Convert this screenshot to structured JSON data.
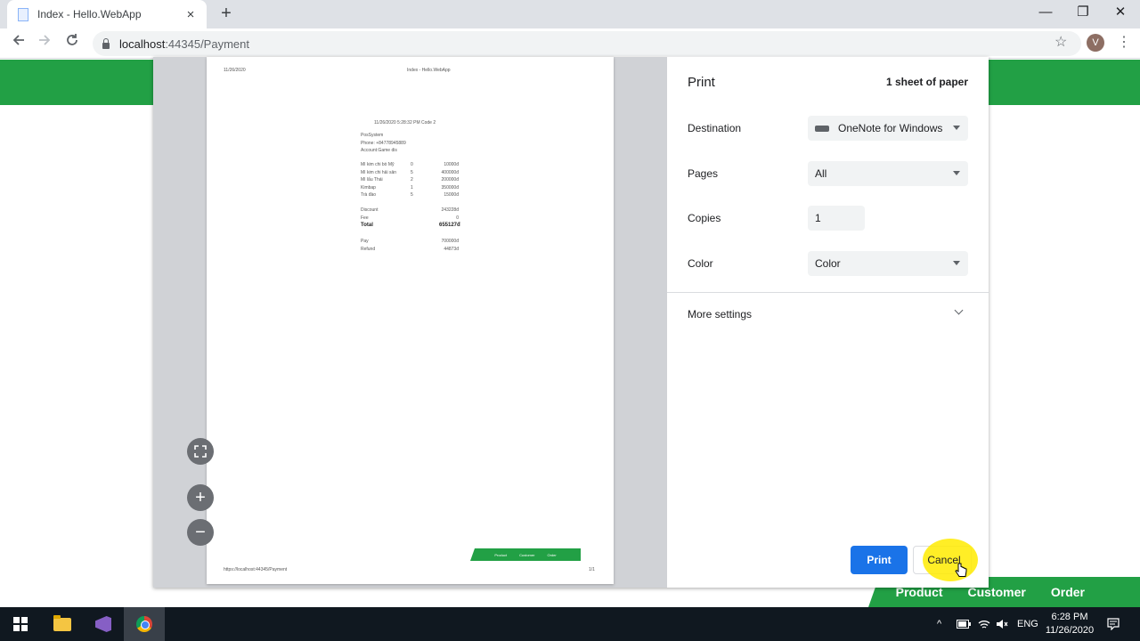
{
  "browser": {
    "tab_title": "Index - Hello.WebApp",
    "tab_close": "×",
    "new_tab": "+",
    "url_host": "localhost",
    "url_path": ":44345/Payment",
    "avatar_letter": "V",
    "window_controls": {
      "minimize": "—",
      "restore": "❐",
      "close": "✕"
    }
  },
  "page_nav": {
    "items": [
      "Product",
      "Customer",
      "Order"
    ]
  },
  "preview": {
    "header_left": "11/26/2020",
    "header_center": "Index - Hello.WebApp",
    "receipt_date": "11/26/2020 5:28:32 PM Code 2",
    "shop": [
      "PosSystem",
      "Phone: +84778945889",
      "Account:Game dis"
    ],
    "items": [
      {
        "name": "Mì kim chi bò Mỹ",
        "qty": "0",
        "price": "10000đ"
      },
      {
        "name": "Mì kim chi hải sản",
        "qty": "5",
        "price": "400000đ"
      },
      {
        "name": "Mì lẩu Thái",
        "qty": "2",
        "price": "200000đ"
      },
      {
        "name": "Kimbap",
        "qty": "1",
        "price": "350000đ"
      },
      {
        "name": "Trà đào",
        "qty": "5",
        "price": "15000đ"
      }
    ],
    "discount_label": "Discount",
    "discount_value": "243228đ",
    "fee_label": "Fee",
    "fee_value": "0",
    "total_label": "Total",
    "total_value": "655127đ",
    "pay_label": "Pay",
    "pay_value": "700000đ",
    "refund_label": "Refund",
    "refund_value": "44873đ",
    "footer_nav": [
      "Product",
      "Customer",
      "Order"
    ],
    "footer_left": "https://localhost:44345/Payment",
    "footer_right": "1/1"
  },
  "print_settings": {
    "title": "Print",
    "sheets": "1 sheet of paper",
    "destination_label": "Destination",
    "destination_value": "OneNote for Windows",
    "pages_label": "Pages",
    "pages_value": "All",
    "copies_label": "Copies",
    "copies_value": "1",
    "color_label": "Color",
    "color_value": "Color",
    "more_settings": "More settings",
    "print_button": "Print",
    "cancel_button": "Cancel"
  },
  "taskbar": {
    "lang": "ENG",
    "time": "6:28 PM",
    "date": "11/26/2020"
  },
  "colors": {
    "brand_green": "#22a045",
    "accent_blue": "#1a73e8"
  }
}
